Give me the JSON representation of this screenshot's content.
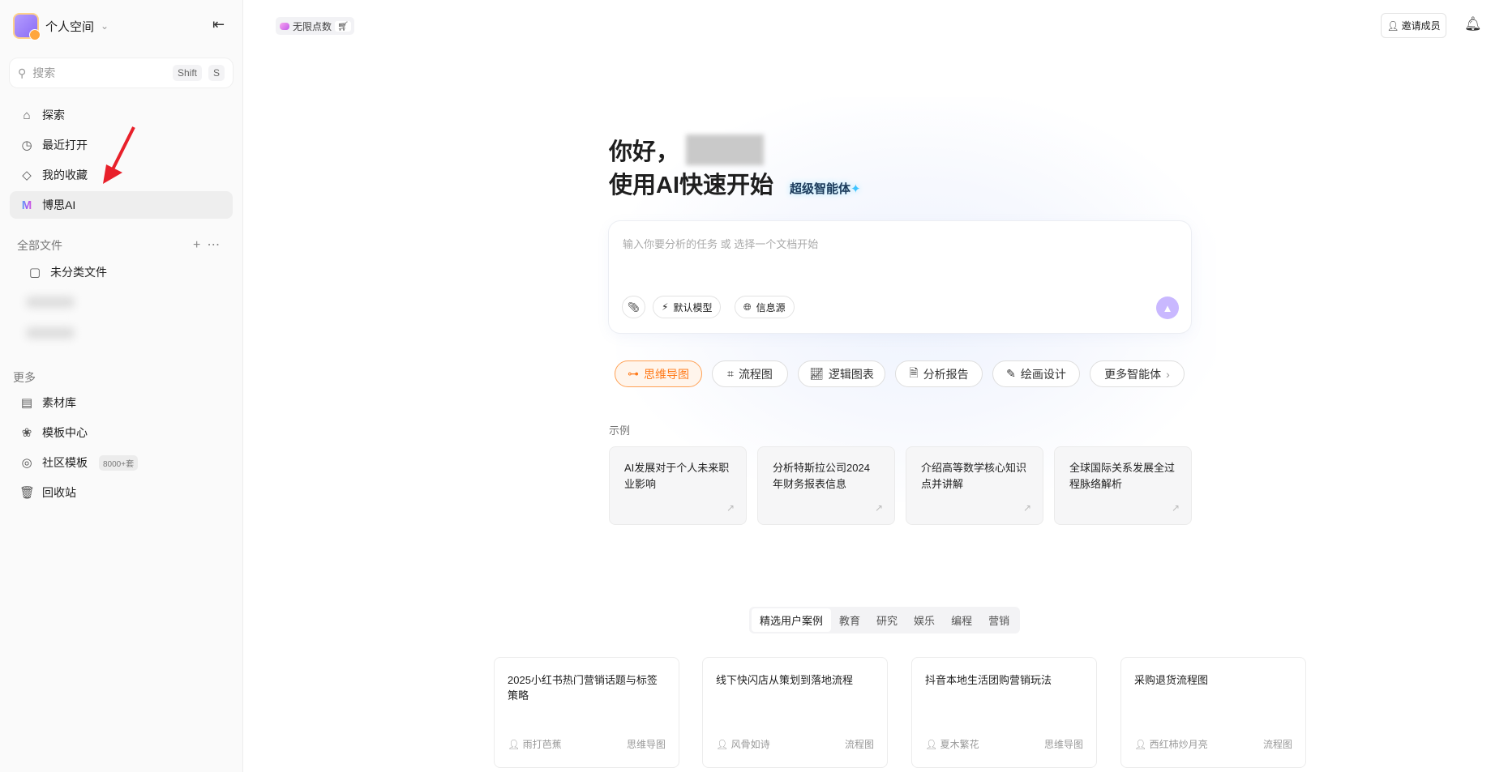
{
  "sidebar": {
    "workspace": "个人空间",
    "search": {
      "placeholder": "搜索",
      "shortcut": [
        "Shift",
        "S"
      ]
    },
    "nav": [
      {
        "label": "探索",
        "icon": "home-icon"
      },
      {
        "label": "最近打开",
        "icon": "clock-icon"
      },
      {
        "label": "我的收藏",
        "icon": "tag-icon"
      },
      {
        "label": "博思AI",
        "icon": "boardmix-ai-icon"
      }
    ],
    "files_header": "全部文件",
    "files": [
      {
        "label": "未分类文件"
      }
    ],
    "more_header": "更多",
    "more": [
      {
        "label": "素材库"
      },
      {
        "label": "模板中心"
      },
      {
        "label": "社区模板",
        "badge": "8000+套"
      },
      {
        "label": "回收站"
      }
    ]
  },
  "topbar": {
    "points": "无限点数",
    "invite": "邀请成员"
  },
  "main": {
    "greeting": "你好，",
    "subtitle": "使用AI快速开始",
    "agent_label": "超级智能体",
    "prompt": {
      "placeholder": "输入你要分析的任务 或 选择一个文档开始",
      "model": "默认模型",
      "source": "信息源"
    },
    "chips": [
      "思维导图",
      "流程图",
      "逻辑图表",
      "分析报告",
      "绘画设计",
      "更多智能体"
    ],
    "examples_label": "示例",
    "examples": [
      "AI发展对于个人未来职业影响",
      "分析特斯拉公司2024年财务报表信息",
      "介绍高等数学核心知识点并讲解",
      "全球国际关系发展全过程脉络解析"
    ],
    "tabs": [
      "精选用户案例",
      "教育",
      "研究",
      "娱乐",
      "编程",
      "营销"
    ],
    "cases": [
      {
        "title": "2025小红书热门营销话题与标签策略",
        "author": "雨打芭蕉",
        "type": "思维导图"
      },
      {
        "title": "线下快闪店从策划到落地流程",
        "author": "风骨如诗",
        "type": "流程图"
      },
      {
        "title": "抖音本地生活团购营销玩法",
        "author": "夏木繁花",
        "type": "思维导图"
      },
      {
        "title": "采购退货流程图",
        "author": "西红柿炒月亮",
        "type": "流程图"
      }
    ]
  },
  "colors": {
    "accent": "#ff7a1a",
    "send": "#c9b8ff",
    "arrow": "#e8202a"
  }
}
